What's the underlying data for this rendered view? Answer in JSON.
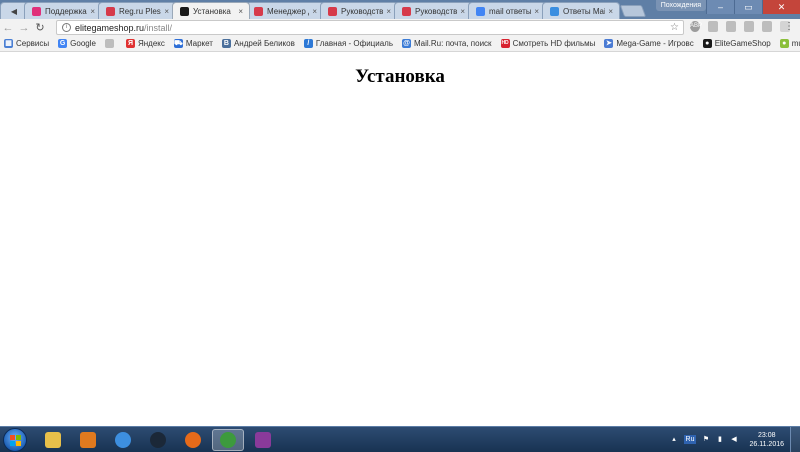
{
  "tabs": [
    {
      "label": "Поддержка",
      "icon": "support-icon",
      "color": "#e0307a"
    },
    {
      "label": "Reg.ru Plesk",
      "icon": "regru-icon",
      "color": "#d63a4a"
    },
    {
      "label": "Установка",
      "icon": "elitegameshop-icon",
      "color": "#1a1a1a",
      "active": true
    },
    {
      "label": "Менеджер д",
      "icon": "regru-icon",
      "color": "#d63a4a"
    },
    {
      "label": "Руководство",
      "icon": "parallels-icon",
      "color": "#d63a4a"
    },
    {
      "label": "Руководство",
      "icon": "parallels-icon",
      "color": "#d63a4a"
    },
    {
      "label": "mail ответы",
      "icon": "google-icon",
      "color": "#4285f4"
    },
    {
      "label": "Ответы Mail",
      "icon": "mail-answers-icon",
      "color": "#3a8ee0"
    }
  ],
  "tab_close_glyph": "×",
  "window": {
    "user": "Похождения",
    "min": "–",
    "max": "▭",
    "close": "✕"
  },
  "address": {
    "domain": "elitegameshop.ru",
    "path": "/install/"
  },
  "extensions": [
    "ABP",
    "",
    "",
    "",
    "",
    ""
  ],
  "bookmarks": [
    {
      "label": "Сервисы",
      "icon": "apps-grid-icon",
      "color": "#4a7fd4",
      "glyph": "▦"
    },
    {
      "label": "Google",
      "icon": "google-icon",
      "color": "#4285f4",
      "glyph": "G"
    },
    {
      "label": "",
      "icon": "page-icon",
      "color": "#bdbdbd",
      "glyph": ""
    },
    {
      "label": "Яндекс",
      "icon": "yandex-icon",
      "color": "#e03131",
      "glyph": "Я"
    },
    {
      "label": "Маркет",
      "icon": "market-cart-icon",
      "color": "#2d6ed6",
      "glyph": "⛟"
    },
    {
      "label": "Андрей Беликов",
      "icon": "vk-icon",
      "color": "#4a6f9c",
      "glyph": "В"
    },
    {
      "label": "Главная - Официаль",
      "icon": "official-icon",
      "color": "#2c78d6",
      "glyph": "/"
    },
    {
      "label": "Mail.Ru: почта, поиск",
      "icon": "mailru-icon",
      "color": "#3b7bd6",
      "glyph": "@"
    },
    {
      "label": "Смотреть HD фильмы",
      "icon": "hd-icon",
      "color": "#d8222f",
      "glyph": "HD"
    },
    {
      "label": "Mega-Game - Игровс",
      "icon": "megagame-icon",
      "color": "#4a7bd4",
      "glyph": "➤"
    },
    {
      "label": "EliteGameShop",
      "icon": "elitegameshop-icon",
      "color": "#1a1a1a",
      "glyph": "●"
    },
    {
      "label": "mulakasakks",
      "icon": "mulakasakks-icon",
      "color": "#8bbf3a",
      "glyph": "●"
    }
  ],
  "page": {
    "title": "Установка"
  },
  "taskbar": {
    "pins": [
      {
        "name": "explorer",
        "color": "#e8c04a"
      },
      {
        "name": "media-player",
        "color": "#e07a1f"
      },
      {
        "name": "vk",
        "color": "#3d8fe0"
      },
      {
        "name": "steam",
        "color": "#1b2838"
      },
      {
        "name": "firefox",
        "color": "#e66a1a"
      },
      {
        "name": "chrome",
        "color": "#3d9a3d",
        "active": true
      },
      {
        "name": "winrar",
        "color": "#8a3a9a"
      }
    ],
    "tray_arrow": "▴",
    "lang": "Ru",
    "time": "23:08",
    "date": "26.11.2016"
  }
}
